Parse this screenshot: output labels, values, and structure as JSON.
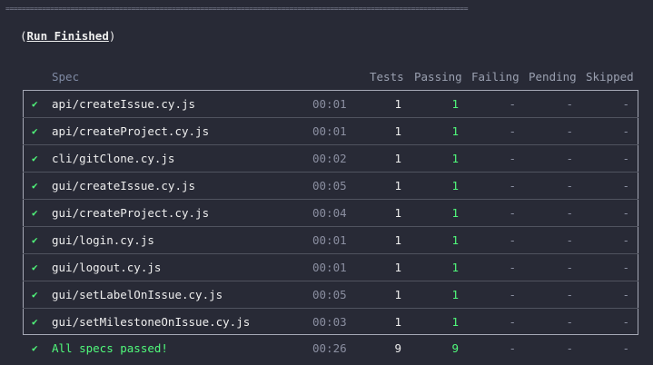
{
  "separator": "==================================================================================================================",
  "run_finished": {
    "open": "(",
    "title": "Run Finished",
    "close": ")"
  },
  "headers": {
    "spec": "Spec",
    "tests": "Tests",
    "passing": "Passing",
    "failing": "Failing",
    "pending": "Pending",
    "skipped": "Skipped"
  },
  "icons": {
    "check": "check-icon",
    "check_glyph": "✔"
  },
  "colors": {
    "background": "#282a36",
    "passing": "#50fa7b",
    "text": "#eeeeee",
    "muted": "#8a8ea0"
  },
  "rows": [
    {
      "spec": "api/createIssue.cy.js",
      "duration": "00:01",
      "tests": "1",
      "passing": "1",
      "failing": "-",
      "pending": "-",
      "skipped": "-"
    },
    {
      "spec": "api/createProject.cy.js",
      "duration": "00:01",
      "tests": "1",
      "passing": "1",
      "failing": "-",
      "pending": "-",
      "skipped": "-"
    },
    {
      "spec": "cli/gitClone.cy.js",
      "duration": "00:02",
      "tests": "1",
      "passing": "1",
      "failing": "-",
      "pending": "-",
      "skipped": "-"
    },
    {
      "spec": "gui/createIssue.cy.js",
      "duration": "00:05",
      "tests": "1",
      "passing": "1",
      "failing": "-",
      "pending": "-",
      "skipped": "-"
    },
    {
      "spec": "gui/createProject.cy.js",
      "duration": "00:04",
      "tests": "1",
      "passing": "1",
      "failing": "-",
      "pending": "-",
      "skipped": "-"
    },
    {
      "spec": "gui/login.cy.js",
      "duration": "00:01",
      "tests": "1",
      "passing": "1",
      "failing": "-",
      "pending": "-",
      "skipped": "-"
    },
    {
      "spec": "gui/logout.cy.js",
      "duration": "00:01",
      "tests": "1",
      "passing": "1",
      "failing": "-",
      "pending": "-",
      "skipped": "-"
    },
    {
      "spec": "gui/setLabelOnIssue.cy.js",
      "duration": "00:05",
      "tests": "1",
      "passing": "1",
      "failing": "-",
      "pending": "-",
      "skipped": "-"
    },
    {
      "spec": "gui/setMilestoneOnIssue.cy.js",
      "duration": "00:03",
      "tests": "1",
      "passing": "1",
      "failing": "-",
      "pending": "-",
      "skipped": "-"
    }
  ],
  "summary": {
    "label": "All specs passed!",
    "duration": "00:26",
    "tests": "9",
    "passing": "9",
    "failing": "-",
    "pending": "-",
    "skipped": "-"
  }
}
